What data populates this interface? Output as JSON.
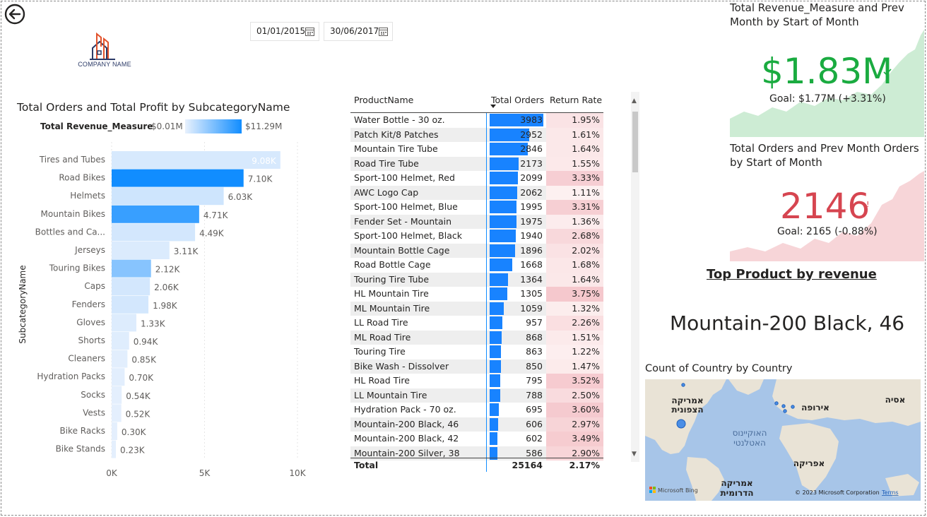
{
  "back_button_label": "Back",
  "date_slicer": {
    "start": "01/01/2015",
    "end": "30/06/2017"
  },
  "logo": {
    "text": "COMPANY NAME"
  },
  "bar_chart": {
    "title": "Total Orders and Total Profit by SubcategoryName",
    "legend_label": "Total Revenue_Measure",
    "legend_min": "$0.01M",
    "legend_max": "$11.29M",
    "y_axis_title": "SubcategoryName",
    "x_ticks": [
      "0K",
      "5K",
      "10K"
    ]
  },
  "chart_data": {
    "type": "bar",
    "orientation": "horizontal",
    "title": "Total Orders and Total Profit by SubcategoryName",
    "ylabel": "SubcategoryName",
    "xlim": [
      0,
      10000
    ],
    "categories": [
      "Tires and Tubes",
      "Road Bikes",
      "Helmets",
      "Mountain Bikes",
      "Bottles and Ca...",
      "Jerseys",
      "Touring Bikes",
      "Caps",
      "Fenders",
      "Gloves",
      "Shorts",
      "Cleaners",
      "Hydration Packs",
      "Socks",
      "Vests",
      "Bike Racks",
      "Bike Stands"
    ],
    "values": [
      9080,
      7100,
      6030,
      4710,
      4490,
      3110,
      2120,
      2060,
      1980,
      1330,
      940,
      850,
      700,
      540,
      520,
      300,
      230
    ],
    "value_labels": [
      "9.08K",
      "7.10K",
      "6.03K",
      "4.71K",
      "4.49K",
      "3.11K",
      "2.12K",
      "2.06K",
      "1.98K",
      "1.33K",
      "0.94K",
      "0.85K",
      "0.70K",
      "0.54K",
      "0.52K",
      "0.30K",
      "0.23K"
    ],
    "color_intensity": [
      0.08,
      1.0,
      0.12,
      0.82,
      0.1,
      0.06,
      0.45,
      0.1,
      0.1,
      0.05,
      0.04,
      0.03,
      0.03,
      0.02,
      0.02,
      0.02,
      0.02
    ]
  },
  "colors": {
    "accent": "#118dff",
    "kpi_green": "#1aab40",
    "kpi_red": "#d64550",
    "green_area": "#cdecd4",
    "red_area": "#f7d5d8",
    "map_water": "#a7c5e8",
    "map_land": "#e9e3d6"
  },
  "table": {
    "headers": {
      "name": "ProductName",
      "orders": "Total Orders",
      "rate": "Return Rate"
    },
    "rows": [
      {
        "name": "Water Bottle - 30 oz.",
        "orders": "3983",
        "rate": "1.95%",
        "orders_value": 3983,
        "rate_value": 1.95
      },
      {
        "name": "Patch Kit/8 Patches",
        "orders": "2952",
        "rate": "1.61%",
        "orders_value": 2952,
        "rate_value": 1.61
      },
      {
        "name": "Mountain Tire Tube",
        "orders": "2846",
        "rate": "1.64%",
        "orders_value": 2846,
        "rate_value": 1.64
      },
      {
        "name": "Road Tire Tube",
        "orders": "2173",
        "rate": "1.55%",
        "orders_value": 2173,
        "rate_value": 1.55
      },
      {
        "name": "Sport-100 Helmet, Red",
        "orders": "2099",
        "rate": "3.33%",
        "orders_value": 2099,
        "rate_value": 3.33
      },
      {
        "name": "AWC Logo Cap",
        "orders": "2062",
        "rate": "1.11%",
        "orders_value": 2062,
        "rate_value": 1.11
      },
      {
        "name": "Sport-100 Helmet, Blue",
        "orders": "1995",
        "rate": "3.31%",
        "orders_value": 1995,
        "rate_value": 3.31
      },
      {
        "name": "Fender Set - Mountain",
        "orders": "1975",
        "rate": "1.36%",
        "orders_value": 1975,
        "rate_value": 1.36
      },
      {
        "name": "Sport-100 Helmet, Black",
        "orders": "1940",
        "rate": "2.68%",
        "orders_value": 1940,
        "rate_value": 2.68
      },
      {
        "name": "Mountain Bottle Cage",
        "orders": "1896",
        "rate": "2.02%",
        "orders_value": 1896,
        "rate_value": 2.02
      },
      {
        "name": "Road Bottle Cage",
        "orders": "1668",
        "rate": "1.68%",
        "orders_value": 1668,
        "rate_value": 1.68
      },
      {
        "name": "Touring Tire Tube",
        "orders": "1364",
        "rate": "1.64%",
        "orders_value": 1364,
        "rate_value": 1.64
      },
      {
        "name": "HL Mountain Tire",
        "orders": "1305",
        "rate": "3.75%",
        "orders_value": 1305,
        "rate_value": 3.75
      },
      {
        "name": "ML Mountain Tire",
        "orders": "1059",
        "rate": "1.32%",
        "orders_value": 1059,
        "rate_value": 1.32
      },
      {
        "name": "LL Road Tire",
        "orders": "957",
        "rate": "2.26%",
        "orders_value": 957,
        "rate_value": 2.26
      },
      {
        "name": "ML Road Tire",
        "orders": "868",
        "rate": "1.51%",
        "orders_value": 868,
        "rate_value": 1.51
      },
      {
        "name": "Touring Tire",
        "orders": "863",
        "rate": "1.22%",
        "orders_value": 863,
        "rate_value": 1.22
      },
      {
        "name": "Bike Wash - Dissolver",
        "orders": "850",
        "rate": "1.47%",
        "orders_value": 850,
        "rate_value": 1.47
      },
      {
        "name": "HL Road Tire",
        "orders": "795",
        "rate": "3.52%",
        "orders_value": 795,
        "rate_value": 3.52
      },
      {
        "name": "LL Mountain Tire",
        "orders": "788",
        "rate": "2.50%",
        "orders_value": 788,
        "rate_value": 2.5
      },
      {
        "name": "Hydration Pack - 70 oz.",
        "orders": "695",
        "rate": "3.60%",
        "orders_value": 695,
        "rate_value": 3.6
      },
      {
        "name": "Mountain-200 Black, 46",
        "orders": "606",
        "rate": "2.97%",
        "orders_value": 606,
        "rate_value": 2.97
      },
      {
        "name": "Mountain-200 Black, 42",
        "orders": "602",
        "rate": "3.49%",
        "orders_value": 602,
        "rate_value": 3.49
      },
      {
        "name": "Mountain-200 Silver, 38",
        "orders": "586",
        "rate": "2.90%",
        "orders_value": 586,
        "rate_value": 2.9
      }
    ],
    "total": {
      "label": "Total",
      "orders": "25164",
      "rate": "2.17%"
    }
  },
  "kpi_revenue": {
    "title": "Total Revenue_Measure and Prev Month by Start of Month",
    "value": "$1.83M",
    "goal": "Goal: $1.77M (+3.31%)",
    "status_icon": "check-icon",
    "trend": "up"
  },
  "kpi_orders": {
    "title": "Total Orders and Prev Month Orders by Start of Month",
    "value": "2146",
    "goal": "Goal: 2165 (-0.88%)",
    "status_icon": "exclamation-icon",
    "trend": "down"
  },
  "top_product": {
    "title": "Top Product by revenue",
    "value": "Mountain-200 Black, 46"
  },
  "map": {
    "title": "Count of Country by Country",
    "labels": {
      "north_america_1": "אמריקה",
      "north_america_2": "הצפונית",
      "europe": "אירופה",
      "asia": "אסיה",
      "atlantic_1": "האוקיינוס",
      "atlantic_2": "האטלנטי",
      "africa": "אפריקה",
      "south_america_1": "אמריקה",
      "south_america_2": "הדרומית"
    },
    "bing": "Microsoft Bing",
    "copyright": "© 2023 Microsoft Corporation",
    "terms": "Terms"
  }
}
